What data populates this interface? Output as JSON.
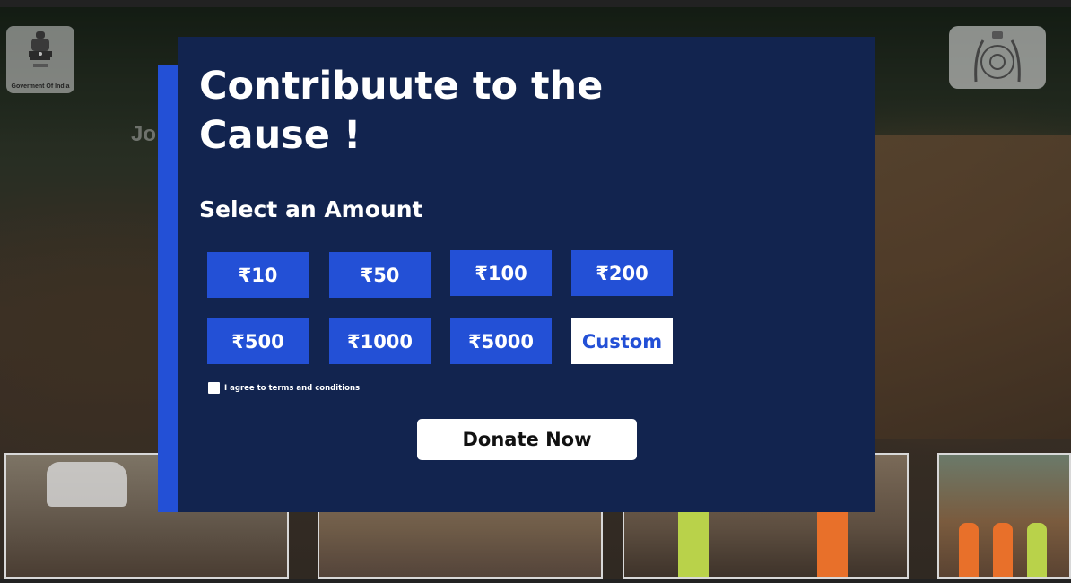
{
  "background": {
    "left_emblem_caption": "Goverment Of India",
    "partial_heading": "Jo"
  },
  "modal": {
    "title_line1": "Contribuute to the",
    "title_line2": "Cause !",
    "subtitle": "Select an Amount",
    "amounts": [
      {
        "label": "₹10"
      },
      {
        "label": "₹50"
      },
      {
        "label": "₹100"
      },
      {
        "label": "₹200"
      },
      {
        "label": "₹500"
      },
      {
        "label": "₹1000"
      },
      {
        "label": "₹5000"
      },
      {
        "label": "Custom"
      }
    ],
    "terms_label": "I agree to terms and conditions",
    "donate_label": "Donate Now"
  },
  "colors": {
    "modal_bg": "#12244f",
    "accent": "#2350d6",
    "text": "#ffffff"
  }
}
